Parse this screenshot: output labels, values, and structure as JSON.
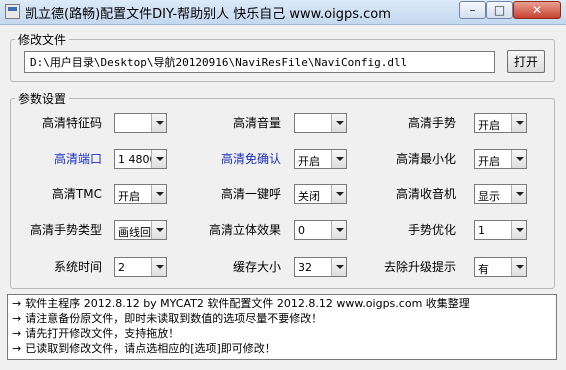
{
  "window": {
    "title": "凯立德(路畅)配置文件DIY-帮助别人 快乐自己 www.oigps.com",
    "min": "–",
    "max": "□",
    "close": "✕"
  },
  "edit_group": {
    "legend": "修改文件",
    "path": "D:\\用户目录\\Desktop\\导航20120916\\NaviResFile\\NaviConfig.dll",
    "open_label": "打开"
  },
  "params_group": {
    "legend": "参数设置",
    "rows": [
      [
        {
          "label": "高清特征码",
          "value": "",
          "blue": false
        },
        {
          "label": "高清音量",
          "value": "",
          "blue": false
        },
        {
          "label": "高清手势",
          "value": "开启",
          "blue": false
        }
      ],
      [
        {
          "label": "高清端口",
          "value": "1 4800",
          "blue": true
        },
        {
          "label": "高清免确认",
          "value": "开启",
          "blue": true
        },
        {
          "label": "高清最小化",
          "value": "开启",
          "blue": false
        }
      ],
      [
        {
          "label": "高清TMC",
          "value": "开启",
          "blue": false
        },
        {
          "label": "高清一键呼",
          "value": "关闭",
          "blue": false
        },
        {
          "label": "高清收音机",
          "value": "显示",
          "blue": false
        }
      ],
      [
        {
          "label": "高清手势类型",
          "value": "画线回",
          "blue": false
        },
        {
          "label": "高清立体效果",
          "value": "0",
          "blue": false
        },
        {
          "label": "手势优化",
          "value": "1",
          "blue": false
        }
      ],
      [
        {
          "label": "系统时间",
          "value": "2",
          "blue": false
        },
        {
          "label": "缓存大小",
          "value": "32",
          "blue": false
        },
        {
          "label": "去除升级提示",
          "value": "有",
          "blue": false
        }
      ]
    ]
  },
  "status_log": [
    {
      "arrow": "→",
      "text": "软件主程序 2012.8.12 by MYCAT2     软件配置文件 2012.8.12 www.oigps.com 收集整理"
    },
    {
      "arrow": "→",
      "text": "请注意备份原文件，即时未读取到数值的选项尽量不要修改！"
    },
    {
      "arrow": "→",
      "text": "请先打开修改文件，支持拖放！"
    },
    {
      "arrow": "→",
      "text": "已读取到修改文件，请点选相应的[选项]即可修改！"
    }
  ]
}
